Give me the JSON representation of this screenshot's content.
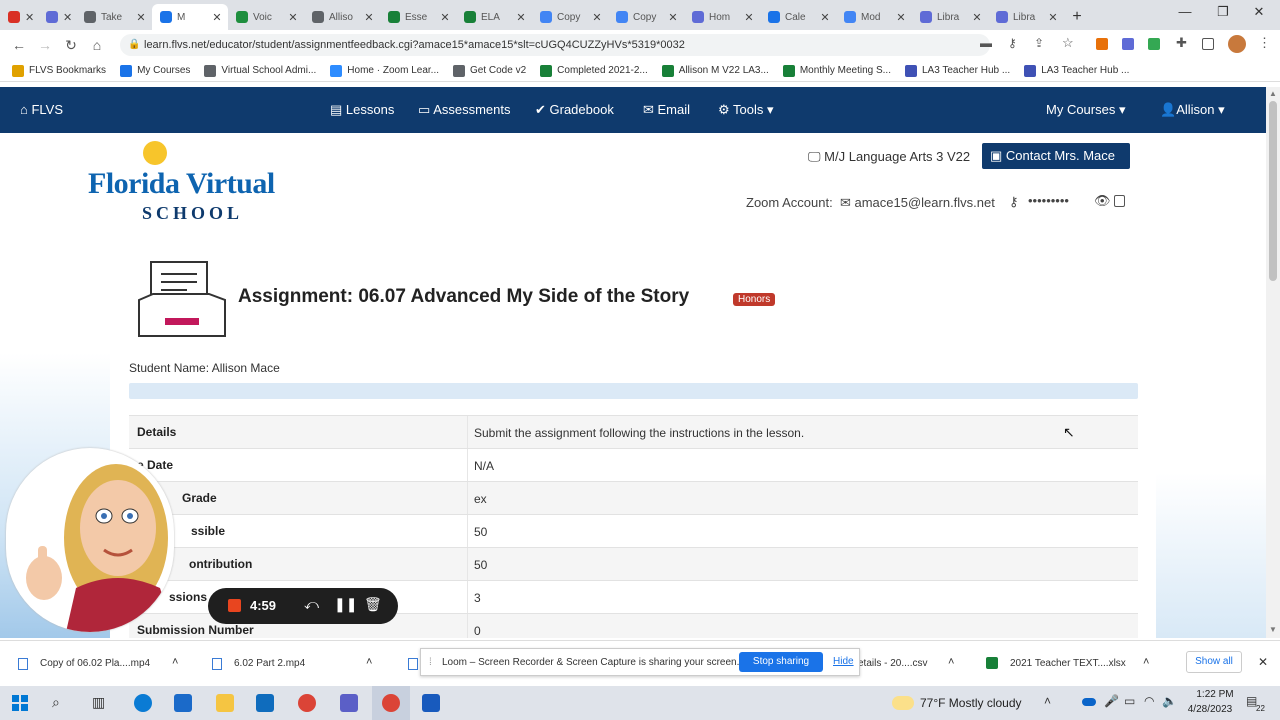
{
  "browser": {
    "tabs": [
      {
        "label": "",
        "color": "#d93025"
      },
      {
        "label": "",
        "color": "#5f6bd6"
      },
      {
        "label": "Take",
        "color": "#5f6368"
      },
      {
        "label": "M",
        "color": "#1a73e8",
        "active": true
      },
      {
        "label": "Voic",
        "color": "#1e8e3e"
      },
      {
        "label": "Alliso",
        "color": "#5f6368"
      },
      {
        "label": "Esse",
        "color": "#188038"
      },
      {
        "label": "ELA",
        "color": "#188038"
      },
      {
        "label": "Copy",
        "color": "#4285f4"
      },
      {
        "label": "Copy",
        "color": "#4285f4"
      },
      {
        "label": "Hom",
        "color": "#5f6bd6"
      },
      {
        "label": "Cale",
        "color": "#1a73e8"
      },
      {
        "label": "Mod",
        "color": "#4285f4"
      },
      {
        "label": "Libra",
        "color": "#5f6bd6"
      },
      {
        "label": "Libra",
        "color": "#5f6bd6"
      }
    ],
    "url": "learn.flvs.net/educator/student/assignmentfeedback.cgi?amace15*amace15*slt=cUGQ4CUZZyHVs*5319*0032",
    "bookmarks": [
      {
        "label": "FLVS Bookmarks",
        "color": "#e0a100"
      },
      {
        "label": "My Courses",
        "color": "#1a73e8"
      },
      {
        "label": "Virtual School Admi...",
        "color": "#5f6368"
      },
      {
        "label": "Home · Zoom Lear...",
        "color": "#2d8cff"
      },
      {
        "label": "Get Code v2",
        "color": "#5f6368"
      },
      {
        "label": "Completed 2021-2...",
        "color": "#188038"
      },
      {
        "label": "Allison M V22 LA3...",
        "color": "#188038"
      },
      {
        "label": "Monthly Meeting S...",
        "color": "#188038"
      },
      {
        "label": "LA3 Teacher Hub ...",
        "color": "#3f51b5"
      },
      {
        "label": "LA3 Teacher Hub ...",
        "color": "#3f51b5"
      }
    ]
  },
  "nav": {
    "brand": "FLVS",
    "lessons": "Lessons",
    "assessments": "Assessments",
    "gradebook": "Gradebook",
    "email": "Email",
    "tools": "Tools",
    "my_courses": "My Courses",
    "user": "Allison"
  },
  "header": {
    "logo_line1": "Florida Virtual",
    "logo_line2": "SCHOOL",
    "course": "M/J Language Arts 3 V22",
    "contact_button": "Contact Mrs. Mace",
    "zoom_label": "Zoom Account:",
    "zoom_email": "amace15@learn.flvs.net",
    "zoom_password": "•••••••••"
  },
  "assignment": {
    "title": "Assignment: 06.07 Advanced My Side of the Story",
    "badge": "Honors",
    "student_name": "Student Name: Allison Mace"
  },
  "table": [
    {
      "label": "Details",
      "value": "Submit the assignment following the instructions in the lesson."
    },
    {
      "label": "e Date",
      "value": "N/A"
    },
    {
      "label": "Grade",
      "value": "ex"
    },
    {
      "label": "ssible",
      "value": "50"
    },
    {
      "label": "ontribution",
      "value": "50"
    },
    {
      "label": "ssions",
      "value": "3"
    },
    {
      "label": "Submission Number",
      "value": "0"
    }
  ],
  "recorder": {
    "time": "4:59"
  },
  "downloads": {
    "items": [
      "Copy of 06.02 Pla....mp4",
      "6.02 Part 2.mp4",
      "etails - 20....csv",
      "2021 Teacher TEXT....xlsx"
    ],
    "show_all": "Show all"
  },
  "loom": {
    "message": "Loom – Screen Recorder & Screen Capture is sharing your screen.",
    "stop": "Stop sharing",
    "hide": "Hide"
  },
  "taskbar": {
    "weather": "77°F  Mostly cloudy",
    "time": "1:22 PM",
    "date": "4/28/2023",
    "notif": "22"
  }
}
